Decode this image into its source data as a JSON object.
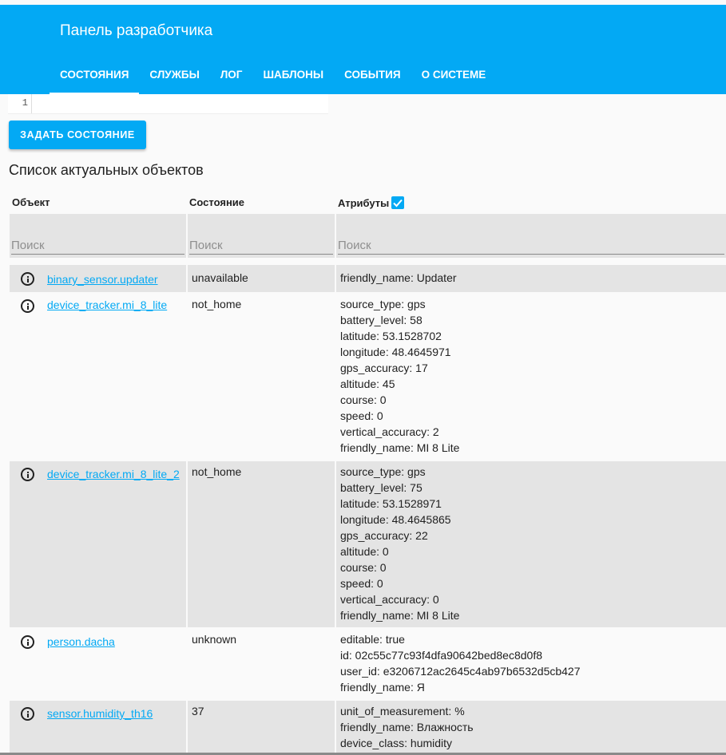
{
  "header": {
    "title": "Панель разработчика",
    "tabs": [
      "СОСТОЯНИЯ",
      "СЛУЖБЫ",
      "ЛОГ",
      "ШАБЛОНЫ",
      "СОБЫТИЯ",
      "О СИСТЕМЕ"
    ],
    "active_tab": "СОСТОЯНИЯ"
  },
  "editor": {
    "line_number": "1",
    "content": ""
  },
  "set_state_button": "ЗАДАТЬ СОСТОЯНИЕ",
  "section_title": "Список актуальных объектов",
  "table": {
    "columns": {
      "entity": "Объект",
      "state": "Состояние",
      "attributes": "Атрибуты"
    },
    "attributes_checked": true,
    "search_placeholders": {
      "entity": "Поиск",
      "state": "Поиск",
      "attributes": "Поиск"
    },
    "rows": [
      {
        "entity": "binary_sensor.updater",
        "state": "unavailable",
        "attributes": [
          "friendly_name: Updater"
        ]
      },
      {
        "entity": "device_tracker.mi_8_lite",
        "state": "not_home",
        "attributes": [
          "source_type: gps",
          "battery_level: 58",
          "latitude: 53.1528702",
          "longitude: 48.4645971",
          "gps_accuracy: 17",
          "altitude: 45",
          "course: 0",
          "speed: 0",
          "vertical_accuracy: 2",
          "friendly_name: MI 8 Lite"
        ]
      },
      {
        "entity": "device_tracker.mi_8_lite_2",
        "state": "not_home",
        "attributes": [
          "source_type: gps",
          "battery_level: 75",
          "latitude: 53.1528971",
          "longitude: 48.4645865",
          "gps_accuracy: 22",
          "altitude: 0",
          "course: 0",
          "speed: 0",
          "vertical_accuracy: 0",
          "friendly_name: MI 8 Lite"
        ]
      },
      {
        "entity": "person.dacha",
        "state": "unknown",
        "attributes": [
          "editable: true",
          "id: 02c55c77c93f4dfa90642bed8ec8d0f8",
          "user_id: e3206712ac2645c4ab97b6532d5cb427",
          "friendly_name: Я"
        ]
      },
      {
        "entity": "sensor.humidity_th16",
        "state": "37",
        "attributes": [
          "unit_of_measurement: %",
          "friendly_name: Влажность",
          "device_class: humidity"
        ]
      }
    ]
  },
  "colors": {
    "primary": "#03a9f4",
    "row_shade": "#e4e4e4",
    "background": "#fafafa"
  }
}
